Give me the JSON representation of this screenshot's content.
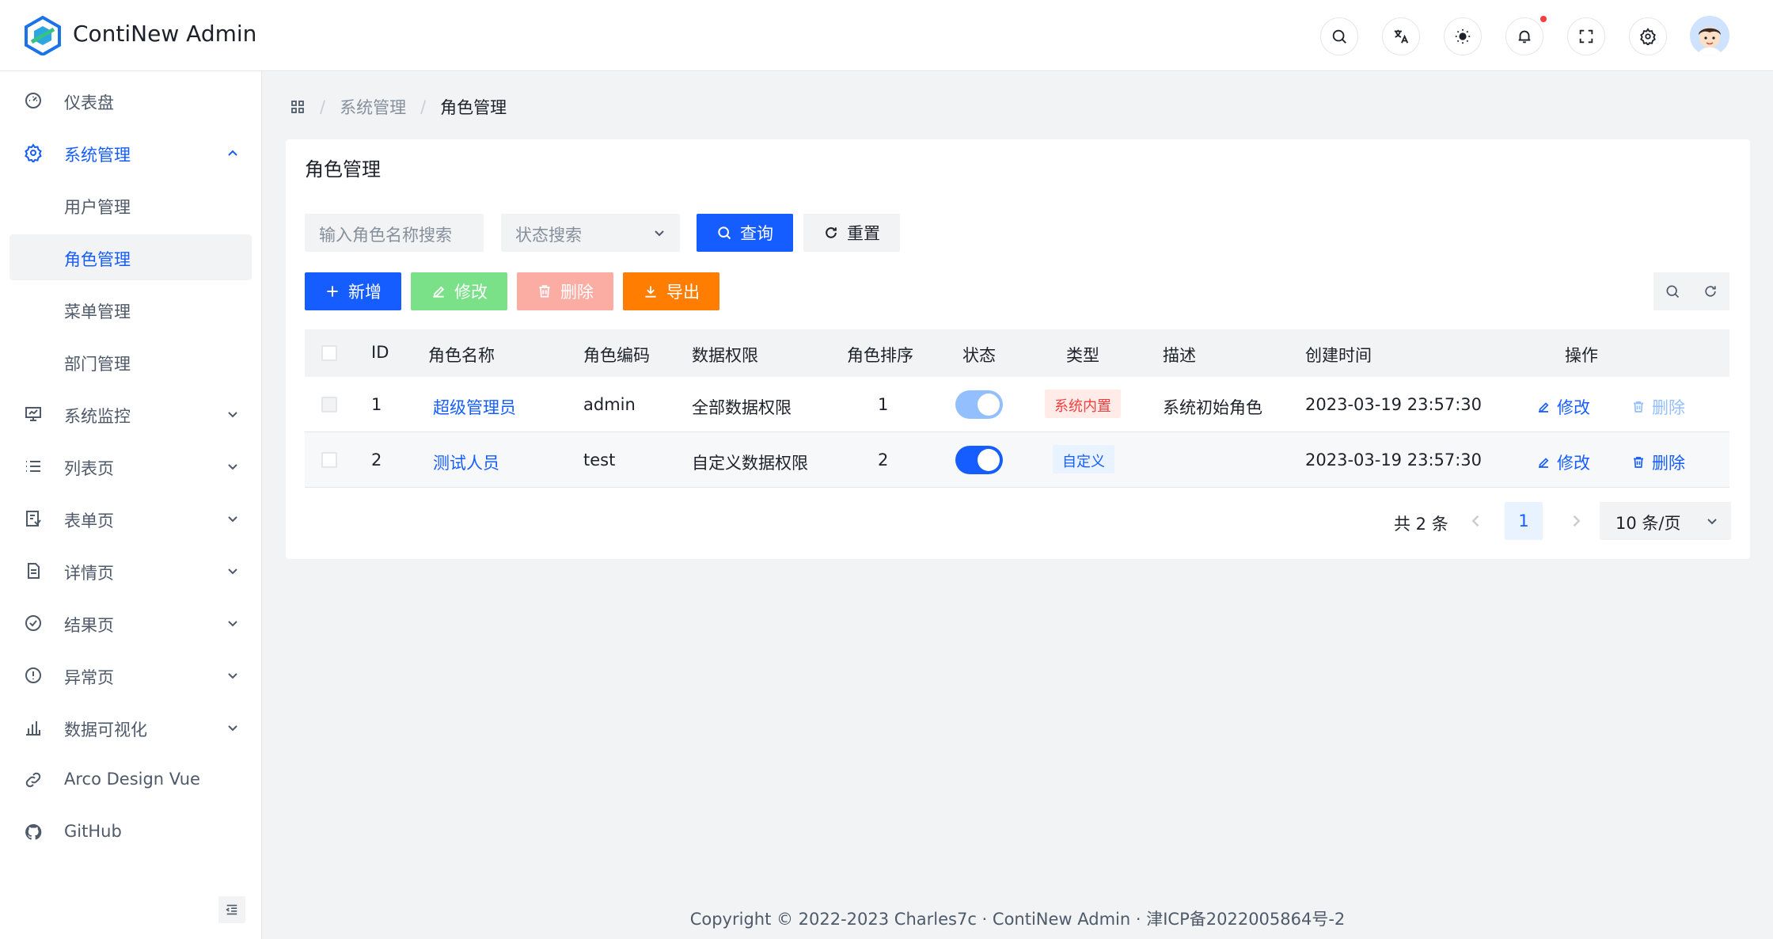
{
  "app": {
    "title": "ContiNew Admin"
  },
  "header": {
    "icons": [
      "search-icon",
      "translate-icon",
      "theme-icon",
      "bell-icon",
      "fullscreen-icon",
      "settings-icon"
    ],
    "has_notification": true
  },
  "sidebar": {
    "items": [
      {
        "label": "仪表盘",
        "icon": "dashboard-icon"
      },
      {
        "label": "系统管理",
        "icon": "gear-icon",
        "expanded": true
      },
      {
        "label": "用户管理"
      },
      {
        "label": "角色管理",
        "active": true
      },
      {
        "label": "菜单管理"
      },
      {
        "label": "部门管理"
      },
      {
        "label": "系统监控",
        "icon": "monitor-icon"
      },
      {
        "label": "列表页",
        "icon": "list-icon"
      },
      {
        "label": "表单页",
        "icon": "form-icon"
      },
      {
        "label": "详情页",
        "icon": "file-icon"
      },
      {
        "label": "结果页",
        "icon": "check-circle-icon"
      },
      {
        "label": "异常页",
        "icon": "exclamation-icon"
      },
      {
        "label": "数据可视化",
        "icon": "bar-chart-icon"
      },
      {
        "label": "Arco Design Vue",
        "icon": "link-icon"
      },
      {
        "label": "GitHub",
        "icon": "github-icon"
      }
    ]
  },
  "breadcrumb": {
    "items": [
      "系统管理",
      "角色管理"
    ]
  },
  "page": {
    "title": "角色管理",
    "search_placeholder": "输入角色名称搜索",
    "status_placeholder": "状态搜索",
    "query_label": "查询",
    "reset_label": "重置",
    "add_label": "新增",
    "edit_label": "修改",
    "delete_label": "删除",
    "export_label": "导出"
  },
  "table": {
    "headers": [
      "ID",
      "角色名称",
      "角色编码",
      "数据权限",
      "角色排序",
      "状态",
      "类型",
      "描述",
      "创建时间",
      "操作"
    ],
    "rows": [
      {
        "id": "1",
        "name": "超级管理员",
        "code": "admin",
        "scope": "全部数据权限",
        "sort": "1",
        "status": true,
        "status_disabled": true,
        "type": "系统内置",
        "desc": "系统初始角色",
        "created": "2023-03-19 23:57:30",
        "edit": "修改",
        "delete": "删除"
      },
      {
        "id": "2",
        "name": "测试人员",
        "code": "test",
        "scope": "自定义数据权限",
        "sort": "2",
        "status": true,
        "status_disabled": false,
        "type": "自定义",
        "desc": "",
        "created": "2023-03-19 23:57:30",
        "edit": "修改",
        "delete": "删除"
      }
    ]
  },
  "pagination": {
    "total": "共 2 条",
    "current": "1",
    "page_size": "10 条/页"
  },
  "footer": {
    "text": "Copyright © 2022-2023 Charles7c · ContiNew Admin · 津ICP备2022005864号-2"
  },
  "colors": {
    "primary": "#165dff",
    "success_light": "#7be188",
    "danger_light": "#fbaca3",
    "warning": "#ff7d00"
  }
}
